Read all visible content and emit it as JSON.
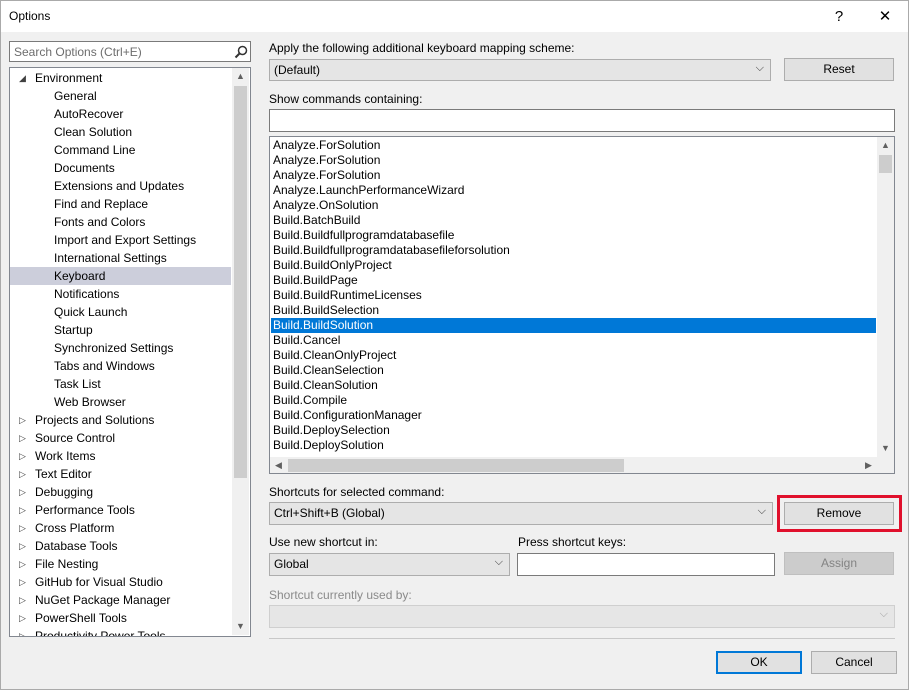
{
  "window": {
    "title": "Options",
    "help_glyph": "?",
    "close_glyph": "✕"
  },
  "search": {
    "placeholder": "Search Options (Ctrl+E)"
  },
  "tree": {
    "environment_label": "Environment",
    "environment_children": [
      "General",
      "AutoRecover",
      "Clean Solution",
      "Command Line",
      "Documents",
      "Extensions and Updates",
      "Find and Replace",
      "Fonts and Colors",
      "Import and Export Settings",
      "International Settings",
      "Keyboard",
      "Notifications",
      "Quick Launch",
      "Startup",
      "Synchronized Settings",
      "Tabs and Windows",
      "Task List",
      "Web Browser"
    ],
    "selected_child": "Keyboard",
    "collapsed_nodes": [
      "Projects and Solutions",
      "Source Control",
      "Work Items",
      "Text Editor",
      "Debugging",
      "Performance Tools",
      "Cross Platform",
      "Database Tools",
      "File Nesting",
      "GitHub for Visual Studio",
      "NuGet Package Manager",
      "PowerShell Tools",
      "Productivity Power Tools"
    ]
  },
  "mapping": {
    "label": "Apply the following additional keyboard mapping scheme:",
    "value": "(Default)",
    "reset_label": "Reset"
  },
  "commands": {
    "label": "Show commands containing:",
    "filter_value": "",
    "items": [
      "Analyze.ForSolution",
      "Analyze.ForSolution",
      "Analyze.ForSolution",
      "Analyze.LaunchPerformanceWizard",
      "Analyze.OnSolution",
      "Build.BatchBuild",
      "Build.Buildfullprogramdatabasefile",
      "Build.Buildfullprogramdatabasefileforsolution",
      "Build.BuildOnlyProject",
      "Build.BuildPage",
      "Build.BuildRuntimeLicenses",
      "Build.BuildSelection",
      "Build.BuildSolution",
      "Build.Cancel",
      "Build.CleanOnlyProject",
      "Build.CleanSelection",
      "Build.CleanSolution",
      "Build.Compile",
      "Build.ConfigurationManager",
      "Build.DeploySelection",
      "Build.DeploySolution"
    ],
    "selected": "Build.BuildSolution"
  },
  "shortcuts": {
    "label": "Shortcuts for selected command:",
    "value": "Ctrl+Shift+B (Global)",
    "remove_label": "Remove"
  },
  "new_shortcut": {
    "scope_label": "Use new shortcut in:",
    "scope_value": "Global",
    "keys_label": "Press shortcut keys:",
    "keys_value": "",
    "assign_label": "Assign"
  },
  "current_usage": {
    "label": "Shortcut currently used by:",
    "value": ""
  },
  "footer": {
    "ok_label": "OK",
    "cancel_label": "Cancel"
  },
  "colors": {
    "highlight": "#e0102c",
    "selection": "#0078d7",
    "tree_selection": "#cccedb"
  }
}
